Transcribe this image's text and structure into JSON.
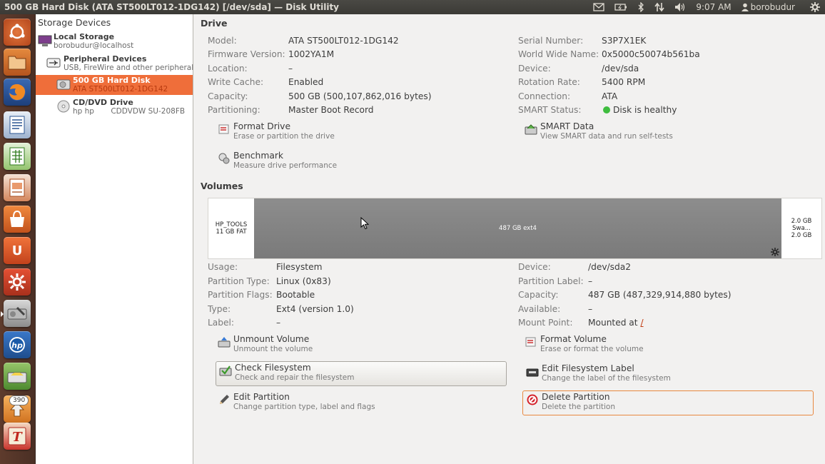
{
  "window": {
    "title": "500 GB Hard Disk (ATA ST500LT012-1DG142) [/dev/sda] — Disk Utility",
    "clock": "9:07 AM",
    "user": "borobudur"
  },
  "launcher": {
    "count_badge": "390"
  },
  "sidebar": {
    "header": "Storage Devices",
    "items": [
      {
        "name": "Local Storage",
        "sub": "borobudur@localhost",
        "icon": "computer-icon"
      },
      {
        "name": "Peripheral Devices",
        "sub": "USB, FireWire and other peripherals",
        "icon": "usb-icon"
      },
      {
        "name": "500 GB Hard Disk",
        "sub": "ATA ST500LT012-1DG142",
        "icon": "harddisk-icon",
        "selected": true
      },
      {
        "name": "CD/DVD Drive",
        "sub": "hp hp       CDDVDW SU-208FB",
        "icon": "optical-drive-icon"
      }
    ]
  },
  "drive": {
    "heading": "Drive",
    "left": [
      {
        "label": "Model:",
        "value": "ATA ST500LT012-1DG142"
      },
      {
        "label": "Firmware Version:",
        "value": "1002YA1M"
      },
      {
        "label": "Location:",
        "value": "–"
      },
      {
        "label": "Write Cache:",
        "value": "Enabled"
      },
      {
        "label": "Capacity:",
        "value": "500 GB (500,107,862,016 bytes)"
      },
      {
        "label": "Partitioning:",
        "value": "Master Boot Record"
      }
    ],
    "right": [
      {
        "label": "Serial Number:",
        "value": "S3P7X1EK"
      },
      {
        "label": "World Wide Name:",
        "value": "0x5000c50074b561ba"
      },
      {
        "label": "Device:",
        "value": "/dev/sda"
      },
      {
        "label": "Rotation Rate:",
        "value": "5400 RPM"
      },
      {
        "label": "Connection:",
        "value": "ATA"
      },
      {
        "label": "SMART Status:",
        "value": "Disk is healthy"
      }
    ],
    "actions": {
      "format": {
        "title": "Format Drive",
        "sub": "Erase or partition the drive"
      },
      "smart": {
        "title": "SMART Data",
        "sub": "View SMART data and run self-tests"
      },
      "benchmark": {
        "title": "Benchmark",
        "sub": "Measure drive performance"
      }
    }
  },
  "volumes": {
    "heading": "Volumes",
    "segments": [
      {
        "line1": "HP_TOOLS",
        "line2": "11 GB FAT"
      },
      {
        "line1": "487 GB ext4",
        "line2": ""
      },
      {
        "line1": "2.0 GB Swa...",
        "line2": "2.0 GB"
      }
    ],
    "left": [
      {
        "label": "Usage:",
        "value": "Filesystem"
      },
      {
        "label": "Partition Type:",
        "value": "Linux (0x83)"
      },
      {
        "label": "Partition Flags:",
        "value": "Bootable"
      },
      {
        "label": "Type:",
        "value": "Ext4 (version 1.0)"
      },
      {
        "label": "Label:",
        "value": "–"
      }
    ],
    "right": [
      {
        "label": "Device:",
        "value": "/dev/sda2"
      },
      {
        "label": "Partition Label:",
        "value": "–"
      },
      {
        "label": "Capacity:",
        "value": "487 GB (487,329,914,880 bytes)"
      },
      {
        "label": "Available:",
        "value": "–"
      },
      {
        "label": "Mount Point:",
        "value": "Mounted at",
        "link": "/"
      }
    ],
    "actions": {
      "unmount": {
        "title": "Unmount Volume",
        "sub": "Unmount the volume"
      },
      "format_volume": {
        "title": "Format Volume",
        "sub": "Erase or format the volume"
      },
      "check_fs": {
        "title": "Check Filesystem",
        "sub": "Check and repair the filesystem"
      },
      "edit_label": {
        "title": "Edit Filesystem Label",
        "sub": "Change the label of the filesystem"
      },
      "edit_partition": {
        "title": "Edit Partition",
        "sub": "Change partition type, label and flags"
      },
      "delete_partition": {
        "title": "Delete Partition",
        "sub": "Delete the partition"
      }
    }
  },
  "colors": {
    "accent_orange": "#ef6e3a",
    "panel_dark": "#3c3b37",
    "healthy_green": "#3fbd3f",
    "launcher_bg": "#5e3b2c"
  }
}
